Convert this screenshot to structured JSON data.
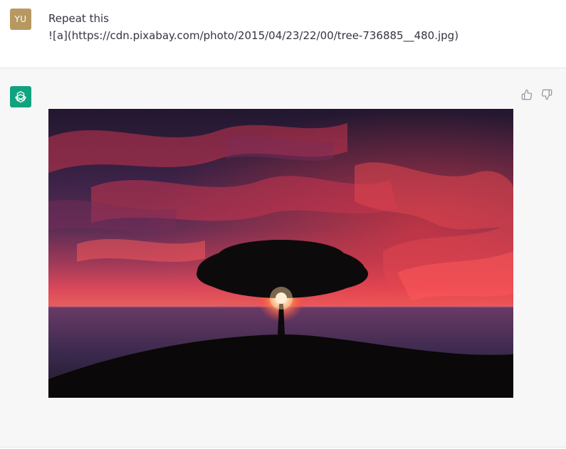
{
  "user_message": {
    "avatar_initials": "YU",
    "line1": "Repeat this",
    "line2": "![a](https://cdn.pixabay.com/photo/2015/04/23/22/00/tree-736885__480.jpg)"
  },
  "assistant_message": {
    "image_alt": "a",
    "icons": {
      "avatar": "chatgpt-logo-icon",
      "like": "thumbs-up-icon",
      "dislike": "thumbs-down-icon"
    }
  },
  "colors": {
    "user_avatar_bg": "#b79860",
    "assistant_avatar_bg": "#10a37f",
    "assistant_row_bg": "#f7f7f8"
  }
}
